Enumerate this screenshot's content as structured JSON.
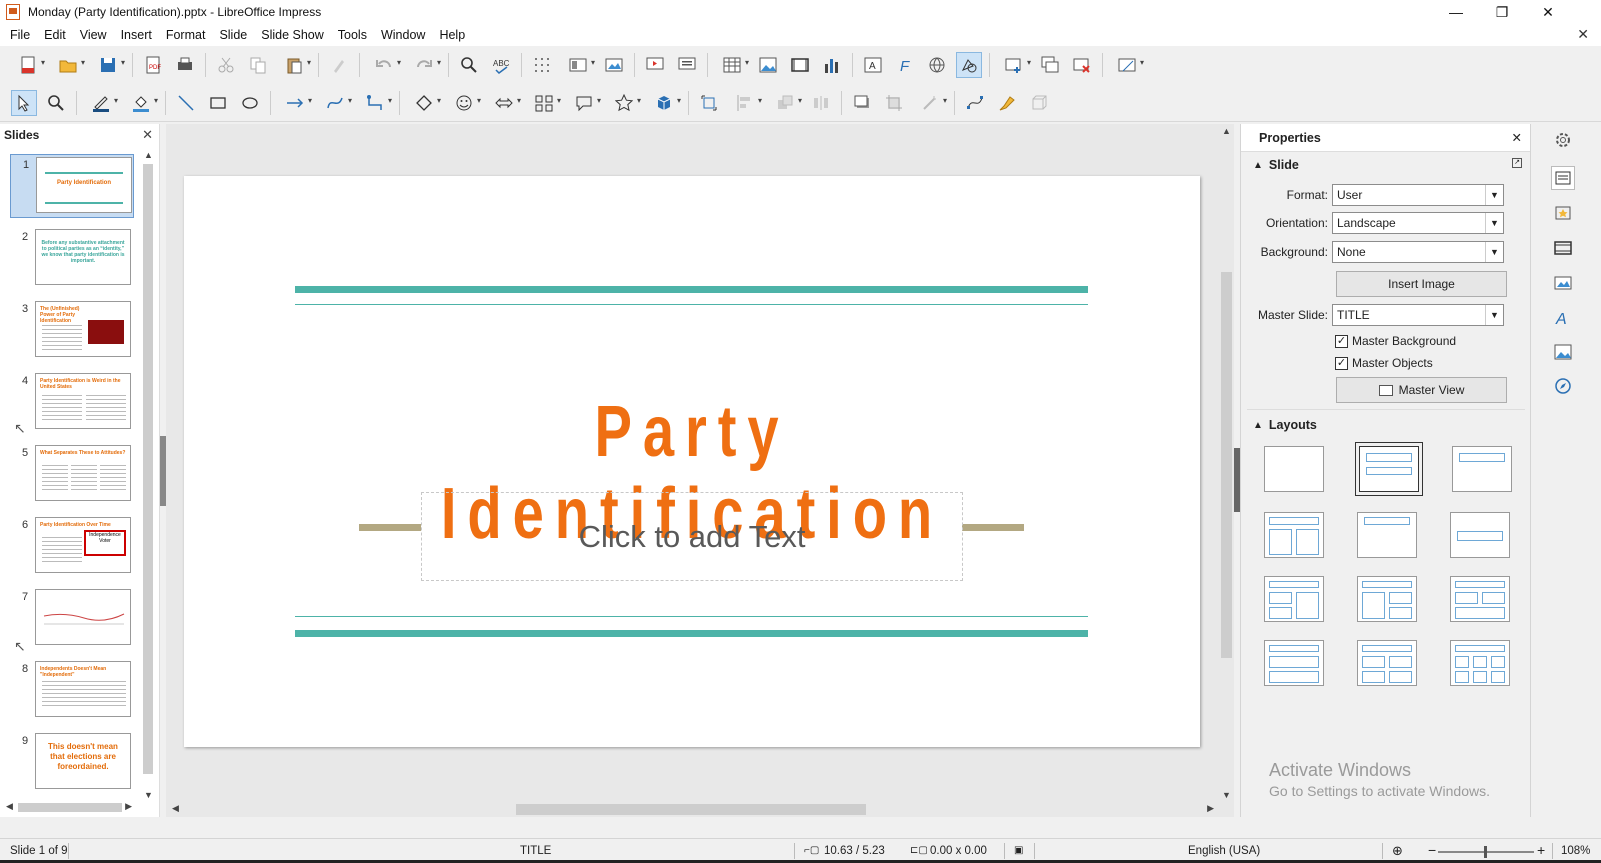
{
  "window": {
    "title": "Monday (Party Identification).pptx - LibreOffice Impress",
    "minimize": "—",
    "maximize": "❐",
    "close": "✕"
  },
  "menu": [
    "File",
    "Edit",
    "View",
    "Insert",
    "Format",
    "Slide",
    "Slide Show",
    "Tools",
    "Window",
    "Help"
  ],
  "doc_close": "✕",
  "slides_panel": {
    "title": "Slides",
    "close": "✕",
    "slides": [
      {
        "number": "1",
        "title": "Party Identification"
      },
      {
        "number": "2",
        "title": "Before any substantive attachment to political parties as an “identity,” we know that party identification is important."
      },
      {
        "number": "3",
        "title": "The (Unfinished) Power of Party Identification"
      },
      {
        "number": "4",
        "title": "Party Identification is Weird in the United States"
      },
      {
        "number": "5",
        "title": "What Separates These to Attitudes?"
      },
      {
        "number": "6",
        "title": "Party Identification Over Time",
        "image_label": "Independence Voter"
      },
      {
        "number": "7",
        "title": ""
      },
      {
        "number": "8",
        "title": "Independents Doesn't Mean \"Independent\""
      },
      {
        "number": "9",
        "title": "This doesn't mean that elections are foreordained."
      }
    ]
  },
  "slide": {
    "title": "Party Identification",
    "subtitle_placeholder": "Click to add Text",
    "colors": {
      "accent_teal": "#4db3a8",
      "title_orange": "#ef6f12",
      "tan": "#b3a882"
    }
  },
  "properties": {
    "title": "Properties",
    "close": "✕",
    "slide_section": "Slide",
    "format_label": "Format:",
    "format_value": "User",
    "orientation_label": "Orientation:",
    "orientation_value": "Landscape",
    "background_label": "Background:",
    "background_value": "None",
    "insert_image": "Insert Image",
    "master_slide_label": "Master Slide:",
    "master_slide_value": "TITLE",
    "master_background": "Master Background",
    "master_objects": "Master Objects",
    "master_view": "Master View",
    "layouts_section": "Layouts",
    "watermark_line1": "Activate Windows",
    "watermark_line2": "Go to Settings to activate Windows."
  },
  "status": {
    "slide_count": "Slide 1 of 9",
    "master": "TITLE",
    "position": "10.63 / 5.23",
    "size": "0.00 x 0.00",
    "language": "English (USA)",
    "zoom": "108%",
    "zoom_out": "−",
    "zoom_in": "+"
  }
}
